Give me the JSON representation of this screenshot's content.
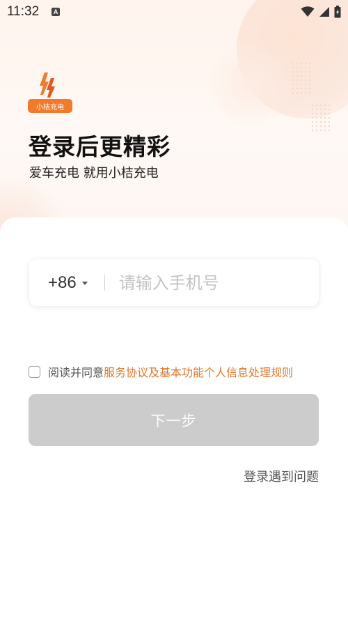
{
  "status_bar": {
    "time": "11:32",
    "a_label": "A"
  },
  "logo": {
    "badge_text": "小桔充电"
  },
  "header": {
    "title": "登录后更精彩",
    "subtitle": "爱车充电 就用小桔充电"
  },
  "phone": {
    "country_code": "+86",
    "placeholder": "请输入手机号",
    "value": ""
  },
  "agreement": {
    "prefix": "阅读并同意",
    "link_text": "服务协议及基本功能个人信息处理规则",
    "checked": false
  },
  "buttons": {
    "next_label": "下一步",
    "help_label": "登录遇到问题"
  },
  "colors": {
    "accent": "#e0782e",
    "logo_orange": "#f07b2c",
    "button_disabled": "#cccccc"
  },
  "icons": [
    "wifi-icon",
    "signal-icon",
    "battery-icon",
    "dropdown-caret-icon"
  ]
}
